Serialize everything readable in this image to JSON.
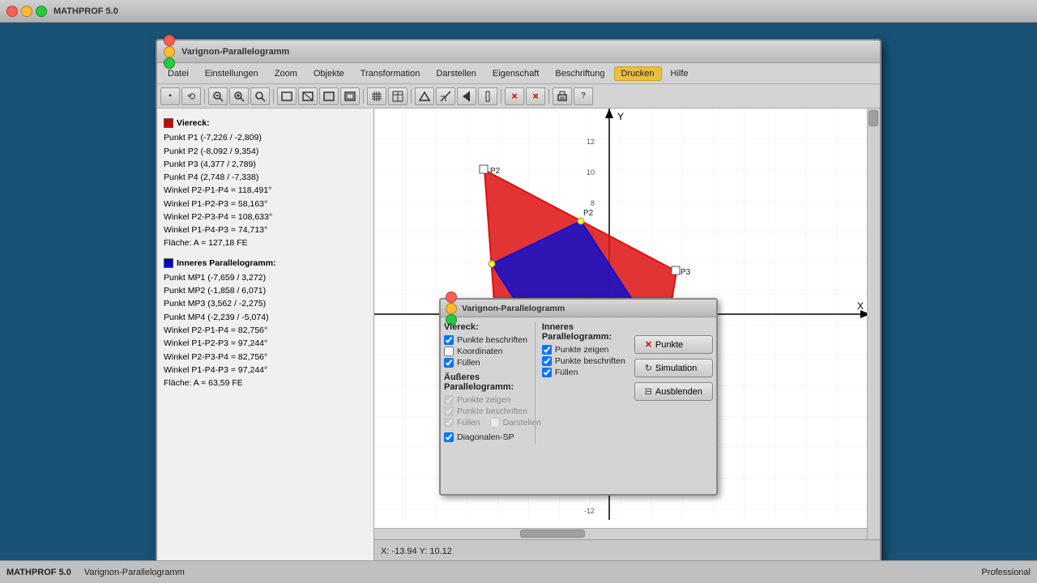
{
  "app": {
    "title": "MATHPROF 5.0",
    "status_left": "MATHPROF 5.0",
    "status_mid": "Varignon-Parallelogramm",
    "status_right": "Professional"
  },
  "window": {
    "title": "Varignon-Parallelogramm"
  },
  "menubar": {
    "items": [
      {
        "label": "Datei"
      },
      {
        "label": "Einstellungen"
      },
      {
        "label": "Zoom"
      },
      {
        "label": "Objekte"
      },
      {
        "label": "Transformation"
      },
      {
        "label": "Darstellen"
      },
      {
        "label": "Eigenschaft"
      },
      {
        "label": "Beschriftung"
      },
      {
        "label": "Drucken"
      },
      {
        "label": "Hilfe"
      }
    ]
  },
  "info_panel": {
    "viereck_label": "Viereck:",
    "viereck_color": "#cc0000",
    "viereck_points": [
      "Punkt P1 (-7,226 / -2,809)",
      "Punkt P2 (-8,092 / 9,354)",
      "Punkt P3 (4,377 / 2,789)",
      "Punkt P4 (2,748 / -7,338)"
    ],
    "viereck_winkel": [
      "Winkel P2-P1-P4 = 118,491°",
      "Winkel P1-P2-P3 = 58,163°",
      "Winkel P2-P3-P4 = 108,633°",
      "Winkel P1-P4-P3 = 74,713°"
    ],
    "viereck_flaeche": "Fläche: A = 127,18 FE",
    "inneres_label": "Inneres Parallelogramm:",
    "inneres_color": "#0000cc",
    "inneres_points": [
      "Punkt MP1 (-7,659 / 3,272)",
      "Punkt MP2 (-1,858 / 6,071)",
      "Punkt MP3 (3,562 / -2,275)",
      "Punkt MP4 (-2,239 / -5,074)"
    ],
    "inneres_winkel": [
      "Winkel P2-P1-P4 = 82,756°",
      "Winkel P1-P2-P3 = 97,244°",
      "Winkel P2-P3-P4 = 82,756°",
      "Winkel P1-P4-P3 = 97,244°"
    ],
    "inneres_flaeche": "Fläche: A = 63,59 FE"
  },
  "canvas": {
    "x_axis_label": "X",
    "y_axis_label": "Y",
    "coords": "X: -13.94  Y: 10.12"
  },
  "dialog": {
    "title": "Varignon-Parallelogramm",
    "viereck_label": "Viereck:",
    "viereck_checks": [
      {
        "label": "Punkte beschriften",
        "checked": true,
        "disabled": false
      },
      {
        "label": "Koordinaten",
        "checked": false,
        "disabled": false
      },
      {
        "label": "Füllen",
        "checked": true,
        "disabled": false
      }
    ],
    "aeusseres_label": "Äußeres Parallelogramm:",
    "aeusseres_checks": [
      {
        "label": "Punkte zeigen",
        "checked": true,
        "disabled": true
      },
      {
        "label": "Punkte beschriften",
        "checked": true,
        "disabled": true
      },
      {
        "label": "Füllen",
        "checked": true,
        "disabled": true
      },
      {
        "label": "Darstellen",
        "checked": false,
        "disabled": true
      }
    ],
    "diagonalen_label": "Diagonalen-SP",
    "diagonalen_checked": true,
    "inneres_label": "Inneres Parallelogramm:",
    "inneres_checks": [
      {
        "label": "Punkte zeigen",
        "checked": true,
        "disabled": false
      },
      {
        "label": "Punkte beschriften",
        "checked": true,
        "disabled": false
      },
      {
        "label": "Füllen",
        "checked": true,
        "disabled": false
      }
    ],
    "buttons": [
      {
        "label": "Punkte",
        "icon": "×"
      },
      {
        "label": "Simulation",
        "icon": "↻"
      },
      {
        "label": "Ausblenden",
        "icon": "⊟"
      }
    ]
  },
  "toolbar": {
    "buttons": [
      "▪",
      "⟲",
      "🔍-",
      "🔍+",
      "🔍",
      "□",
      "□",
      "□",
      "□",
      "▦",
      "⊞",
      "↕",
      "⤢",
      "┤",
      "×",
      "×",
      "🖨",
      "?"
    ]
  }
}
